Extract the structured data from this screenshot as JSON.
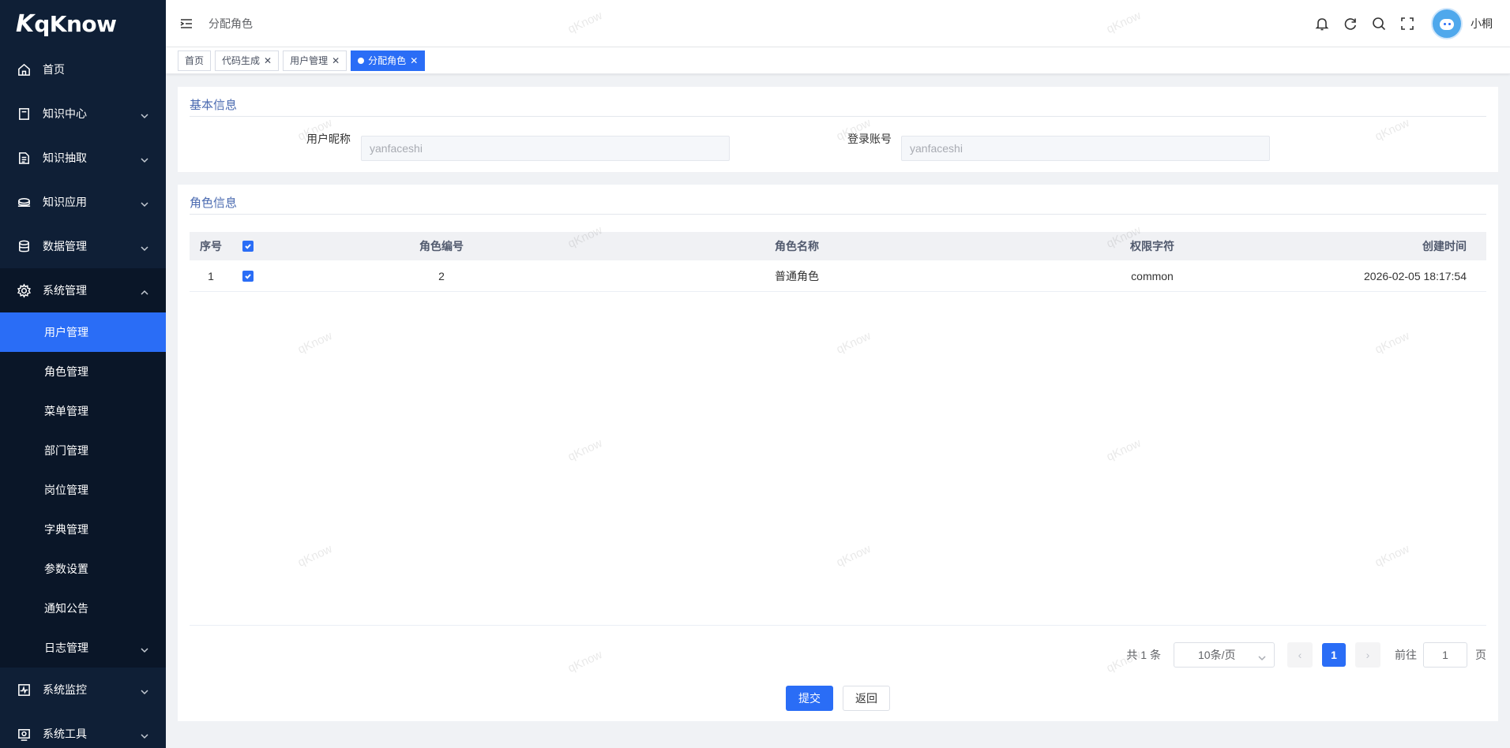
{
  "app": {
    "logo_mark": "K",
    "logo_name": "qKnow"
  },
  "sidebar": {
    "items": [
      {
        "label": "首页",
        "icon": "home-icon"
      },
      {
        "label": "知识中心",
        "icon": "book-icon"
      },
      {
        "label": "知识抽取",
        "icon": "document-icon"
      },
      {
        "label": "知识应用",
        "icon": "apply-icon"
      },
      {
        "label": "数据管理",
        "icon": "database-icon"
      },
      {
        "label": "系统管理",
        "icon": "gear-icon"
      },
      {
        "label": "系统监控",
        "icon": "monitor-icon"
      },
      {
        "label": "系统工具",
        "icon": "tool-icon"
      }
    ],
    "sub_items": [
      {
        "label": "用户管理"
      },
      {
        "label": "角色管理"
      },
      {
        "label": "菜单管理"
      },
      {
        "label": "部门管理"
      },
      {
        "label": "岗位管理"
      },
      {
        "label": "字典管理"
      },
      {
        "label": "参数设置"
      },
      {
        "label": "通知公告"
      },
      {
        "label": "日志管理"
      }
    ]
  },
  "header": {
    "breadcrumb": "分配角色",
    "username": "小桐"
  },
  "tags": [
    {
      "label": "首页"
    },
    {
      "label": "代码生成"
    },
    {
      "label": "用户管理"
    },
    {
      "label": "分配角色"
    }
  ],
  "basic_info": {
    "title": "基本信息",
    "nickname_label": "用户昵称",
    "nickname_value": "yanfaceshi",
    "account_label": "登录账号",
    "account_value": "yanfaceshi"
  },
  "role_info": {
    "title": "角色信息",
    "columns": [
      "序号",
      "角色编号",
      "角色名称",
      "权限字符",
      "创建时间"
    ],
    "rows": [
      {
        "index": "1",
        "code": "2",
        "name": "普通角色",
        "perm": "common",
        "created": "2026-02-05 18:17:54"
      }
    ]
  },
  "pagination": {
    "total": "共 1 条",
    "page_size": "10条/页",
    "prev": "‹",
    "current": "1",
    "next": "›",
    "goto_label": "前往",
    "goto_value": "1",
    "page_suffix": "页"
  },
  "actions": {
    "submit": "提交",
    "back": "返回"
  },
  "watermark": "qKnow",
  "colors": {
    "accent": "#2a6df6",
    "sidebar_bg": "#0f1f36",
    "section_title": "#4a6ab0"
  }
}
